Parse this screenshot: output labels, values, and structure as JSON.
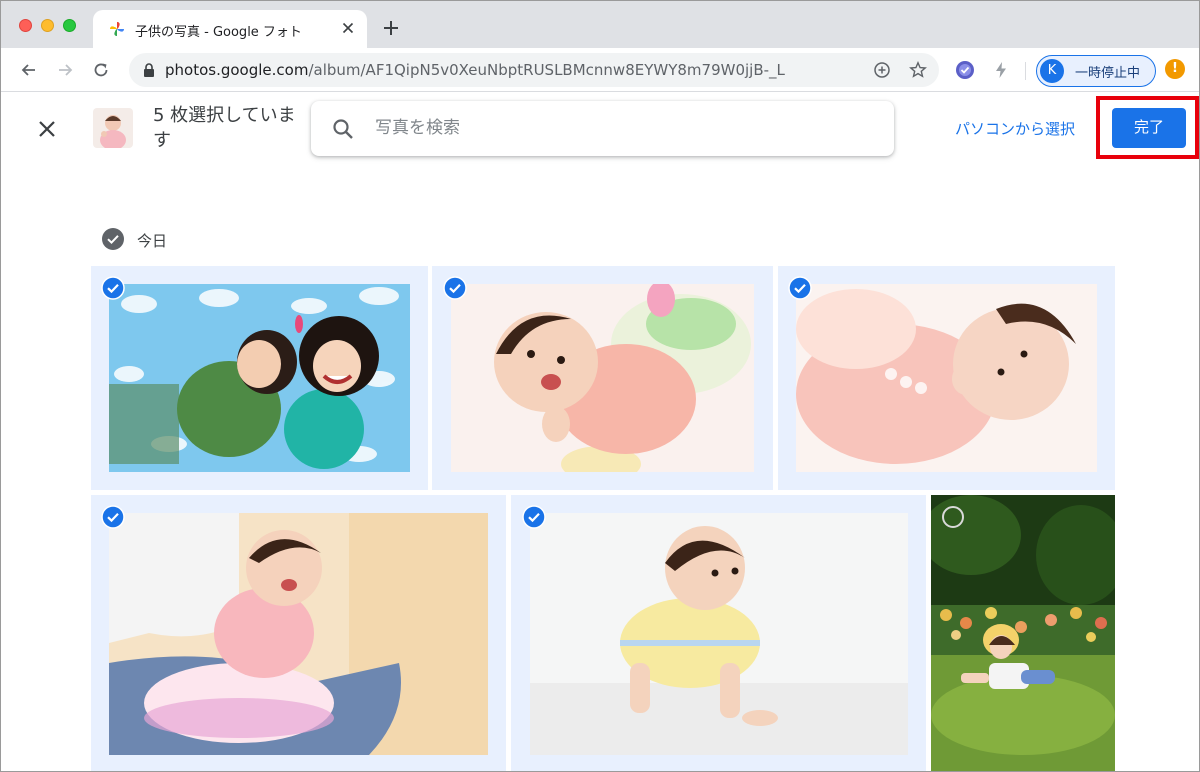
{
  "browser": {
    "tab_title": "子供の写真 - Google フォト",
    "url_host": "photos.google.com",
    "url_path": "/album/AF1QipN5v0XeuNbptRUSLBMcnnw8EYWY8m79W0jjB-_L",
    "profile_initial": "K",
    "profile_label": "一時停止中",
    "alert_symbol": "!"
  },
  "header": {
    "selected_count": "5 枚選択していま す",
    "search_placeholder": "写真を検索",
    "upload_link": "パソコンから選択",
    "done_label": "完了"
  },
  "section": {
    "date_label": "今日"
  },
  "photos": [
    {
      "description": "two laughing kids on blue cloud blanket",
      "selected": true
    },
    {
      "description": "smiling baby in pink",
      "selected": true
    },
    {
      "description": "baby lying in pink outfit",
      "selected": true
    },
    {
      "description": "baby sitting on lap in tutu",
      "selected": true
    },
    {
      "description": "crawling baby",
      "selected": true
    },
    {
      "description": "girl lying on grass with flowers",
      "selected": false
    }
  ],
  "colors": {
    "accent": "#1a73e8",
    "highlight_box": "#e8000b",
    "selected_tile": "#e8f0fe"
  }
}
